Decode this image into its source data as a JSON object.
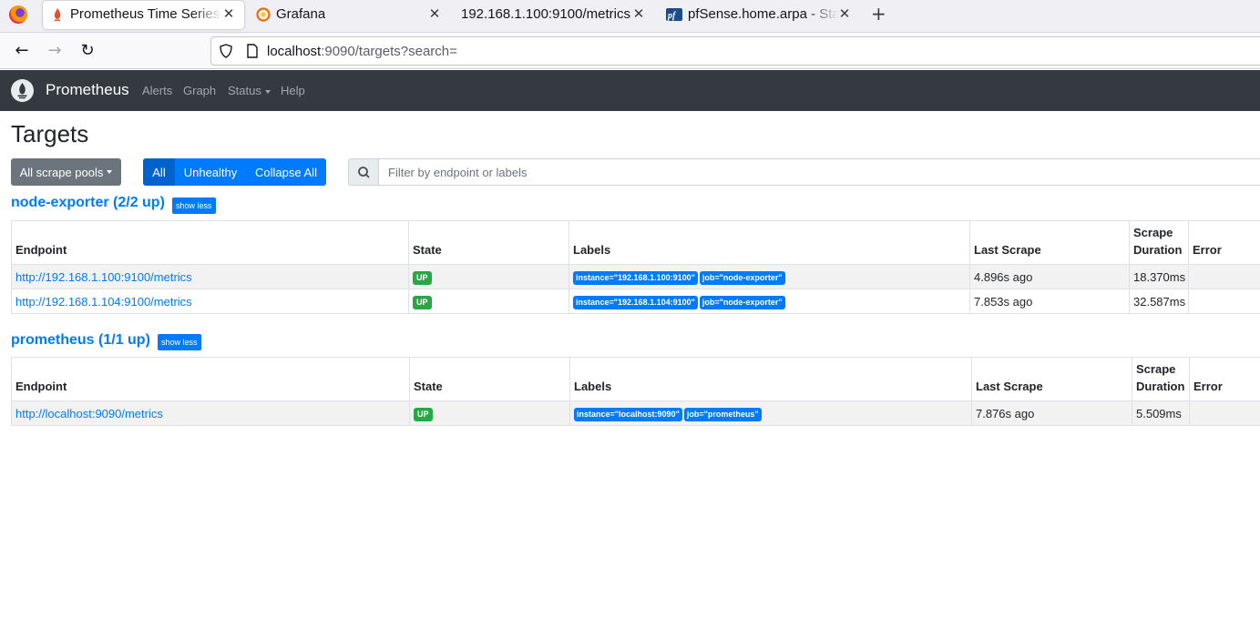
{
  "browser": {
    "tabs": [
      {
        "title": "Prometheus Time Series Collection",
        "favicon": "prometheus-favicon",
        "active": true
      },
      {
        "title": "Grafana",
        "favicon": "grafana-favicon",
        "active": false
      },
      {
        "title": "192.168.1.100:9100/metrics",
        "favicon": "",
        "active": false
      },
      {
        "title": "pfSense.home.arpa - Status",
        "favicon": "pfsense-favicon",
        "active": false
      }
    ],
    "close_glyph": "✕",
    "new_tab_glyph": "+",
    "back_glyph": "←",
    "forward_glyph": "→",
    "reload_glyph": "↻",
    "url_host": "localhost",
    "url_rest": ":9090/targets?search="
  },
  "nav": {
    "brand": "Prometheus",
    "links": [
      "Alerts",
      "Graph",
      "Status",
      "Help"
    ]
  },
  "page": {
    "title": "Targets",
    "scrape_pool_button": "All scrape pools",
    "filters": [
      "All",
      "Unhealthy",
      "Collapse All"
    ],
    "search_placeholder": "Filter by endpoint or labels"
  },
  "columns": [
    "Endpoint",
    "State",
    "Labels",
    "Last Scrape",
    "Scrape Duration",
    "Error"
  ],
  "pools": [
    {
      "title": "node-exporter (2/2 up)",
      "toggle": "show less",
      "rows": [
        {
          "endpoint": "http://192.168.1.100:9100/metrics",
          "state": "UP",
          "labels": [
            "instance=\"192.168.1.100:9100\"",
            "job=\"node-exporter\""
          ],
          "last_scrape": "4.896s ago",
          "duration": "18.370ms",
          "error": ""
        },
        {
          "endpoint": "http://192.168.1.104:9100/metrics",
          "state": "UP",
          "labels": [
            "instance=\"192.168.1.104:9100\"",
            "job=\"node-exporter\""
          ],
          "last_scrape": "7.853s ago",
          "duration": "32.587ms",
          "error": ""
        }
      ]
    },
    {
      "title": "prometheus (1/1 up)",
      "toggle": "show less",
      "rows": [
        {
          "endpoint": "http://localhost:9090/metrics",
          "state": "UP",
          "labels": [
            "instance=\"localhost:9090\"",
            "job=\"prometheus\""
          ],
          "last_scrape": "7.876s ago",
          "duration": "5.509ms",
          "error": ""
        }
      ]
    }
  ],
  "colors": {
    "navbar": "#343a40",
    "primary": "#007bff",
    "success": "#28a745",
    "secondary": "#6c757d"
  }
}
